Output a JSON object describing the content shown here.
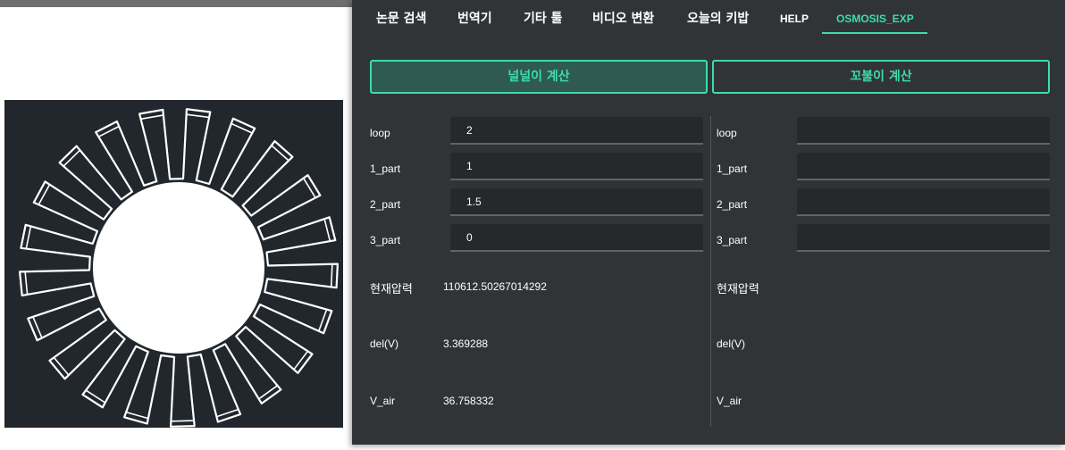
{
  "tabs": [
    {
      "label": "논문 검색",
      "active": false
    },
    {
      "label": "번역기",
      "active": false
    },
    {
      "label": "기타 툴",
      "active": false
    },
    {
      "label": "비디오 변환",
      "active": false
    },
    {
      "label": "오늘의 키밥",
      "active": false
    },
    {
      "label": "HELP",
      "active": false
    },
    {
      "label": "OSMOSIS_EXP",
      "active": true
    }
  ],
  "buttons": {
    "left_label": "널널이 계산",
    "right_label": "꼬불이 계산"
  },
  "left_form": {
    "loop_label": "loop",
    "loop_value": "2",
    "part1_label": "1_part",
    "part1_value": "1",
    "part2_label": "2_part",
    "part2_value": "1.5",
    "part3_label": "3_part",
    "part3_value": "0",
    "pressure_label": "현재압력",
    "pressure_value": "110612.50267014292",
    "delv_label": "del(V)",
    "delv_value": "3.369288",
    "vair_label": "V_air",
    "vair_value": "36.758332"
  },
  "right_form": {
    "loop_label": "loop",
    "loop_value": "",
    "part1_label": "1_part",
    "part1_value": "",
    "part2_label": "2_part",
    "part2_value": "",
    "part3_label": "3_part",
    "part3_value": "",
    "pressure_label": "현재압력",
    "delv_label": "del(V)",
    "vair_label": "V_air"
  },
  "colors": {
    "accent": "#3ddcac",
    "panel_bg": "#313437",
    "field_bg": "#26282b",
    "preview_bg": "#22272d"
  }
}
